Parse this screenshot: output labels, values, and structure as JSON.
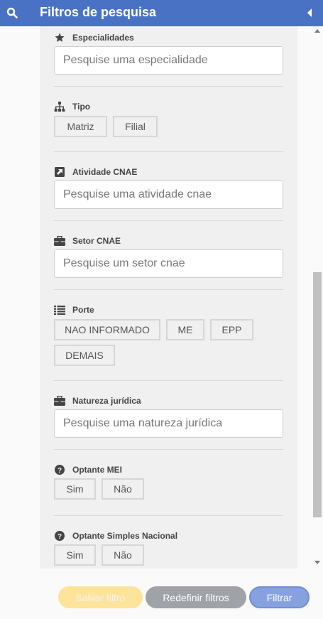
{
  "header": {
    "title": "Filtros de pesquisa",
    "search_icon": "search-icon",
    "collapse_icon": "caret-left-icon",
    "color": "#4a72c4"
  },
  "sections": {
    "especialidades": {
      "label": "Especialidades",
      "icon": "star-icon",
      "placeholder": "Pesquise uma especialidade"
    },
    "tipo": {
      "label": "Tipo",
      "icon": "sitemap-icon",
      "options": [
        "Matriz",
        "Filial"
      ]
    },
    "atividade": {
      "label": "Atividade CNAE",
      "icon": "external-link-icon",
      "placeholder": "Pesquise uma atividade cnae"
    },
    "setor": {
      "label": "Setor CNAE",
      "icon": "briefcase-icon",
      "placeholder": "Pesquise um setor cnae"
    },
    "porte": {
      "label": "Porte",
      "icon": "list-icon",
      "options": [
        "NAO INFORMADO",
        "ME",
        "EPP",
        "DEMAIS"
      ]
    },
    "natureza": {
      "label": "Natureza jurídica",
      "icon": "briefcase-icon",
      "placeholder": "Pesquise uma natureza jurídica"
    },
    "mei": {
      "label": "Optante MEI",
      "icon": "question-circle-icon",
      "options": [
        "Sim",
        "Não"
      ]
    },
    "simples": {
      "label": "Optante Simples Nacional",
      "icon": "question-circle-icon",
      "options": [
        "Sim",
        "Não"
      ]
    }
  },
  "footer": {
    "save_label": "Salvar filtro",
    "reset_label": "Redefinir filtros",
    "filter_label": "Filtrar",
    "colors": {
      "save": "#fde49a",
      "reset": "#9fa2a6",
      "filter": "#87a1de"
    }
  }
}
